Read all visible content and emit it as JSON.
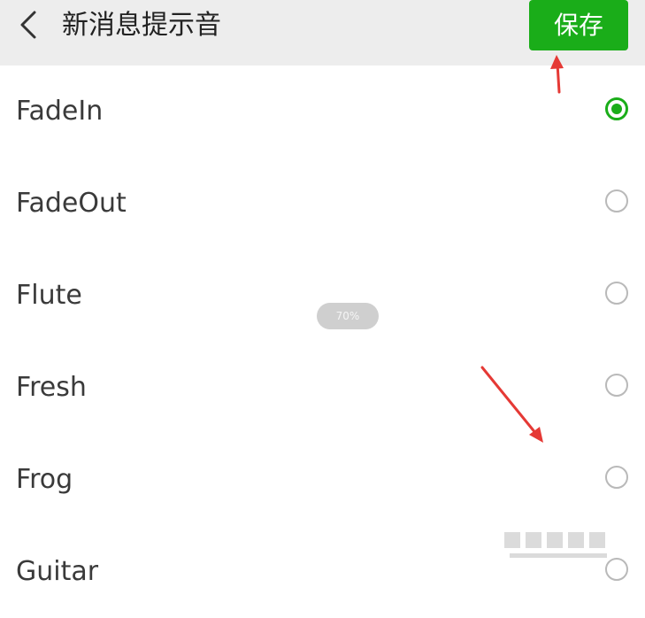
{
  "header": {
    "title": "新消息提示音",
    "back_icon": "chevron-left-icon",
    "save_label": "保存"
  },
  "colors": {
    "accent": "#1aad19",
    "header_bg": "#ededed",
    "annotation_red": "#e53935"
  },
  "tones": [
    {
      "label": "FadeIn",
      "selected": true
    },
    {
      "label": "FadeOut",
      "selected": false
    },
    {
      "label": "Flute",
      "selected": false
    },
    {
      "label": "Fresh",
      "selected": false
    },
    {
      "label": "Frog",
      "selected": false
    },
    {
      "label": "Guitar",
      "selected": false
    }
  ],
  "zoom_indicator": "70%"
}
